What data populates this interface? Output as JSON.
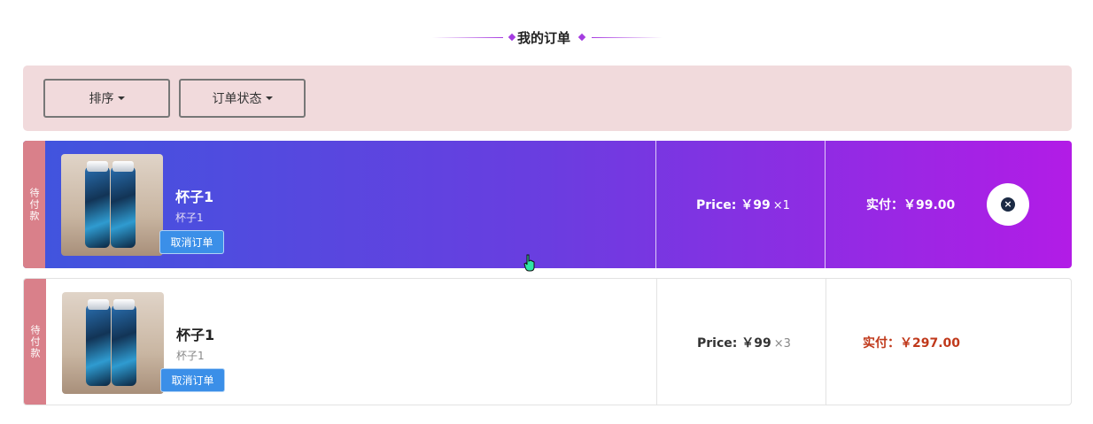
{
  "header": {
    "title": "我的订单"
  },
  "filters": {
    "sort_label": "排序",
    "status_label": "订单状态"
  },
  "orders": [
    {
      "status_tag": "待付款",
      "product_name": "杯子1",
      "product_sub": "杯子1",
      "cancel_label": "取消订单",
      "price_text": "Price: ￥99",
      "qty_text": "×1",
      "paid_text": "实付：￥99.00",
      "style": "highlighted"
    },
    {
      "status_tag": "待付款",
      "product_name": "杯子1",
      "product_sub": "杯子1",
      "cancel_label": "取消订单",
      "price_text": "Price: ￥99",
      "qty_text": "×3",
      "paid_text": "实付：￥297.00",
      "style": "normal"
    }
  ],
  "colors": {
    "accent_purple": "#a73be0",
    "filter_bg": "#f1dadc",
    "status_tag_bg": "#d9808a",
    "cancel_btn_bg": "#3b8fe8",
    "paid_red": "#c0391b",
    "gradient_start": "#3f55de",
    "gradient_end": "#b21ce6"
  },
  "icons": [
    "close-circle-icon",
    "caret-down-icon",
    "hand-pointer-cursor-icon"
  ]
}
